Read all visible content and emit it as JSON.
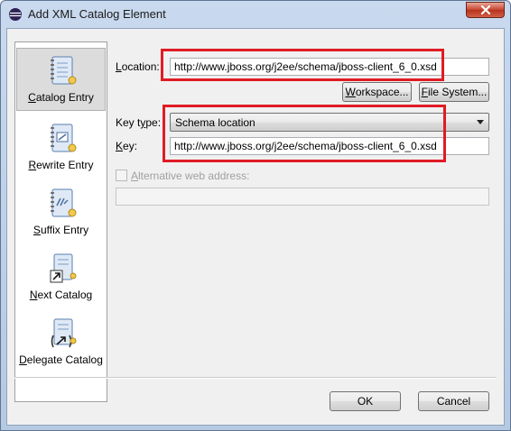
{
  "window": {
    "title": "Add XML Catalog Element"
  },
  "sidebar": {
    "items": [
      {
        "label": "Catalog Entry",
        "mnemonic": "C",
        "rest": "atalog Entry",
        "icon": "catalog-entry-icon",
        "selected": true
      },
      {
        "label": "Rewrite Entry",
        "mnemonic": "R",
        "rest": "ewrite Entry",
        "icon": "rewrite-entry-icon",
        "selected": false
      },
      {
        "label": "Suffix Entry",
        "mnemonic": "S",
        "rest": "uffix Entry",
        "icon": "suffix-entry-icon",
        "selected": false
      },
      {
        "label": "Next Catalog",
        "mnemonic": "N",
        "rest": "ext Catalog",
        "icon": "next-catalog-icon",
        "selected": false
      },
      {
        "label": "Delegate Catalog",
        "mnemonic": "D",
        "rest": "elegate Catalog",
        "icon": "delegate-catalog-icon",
        "selected": false
      }
    ]
  },
  "form": {
    "location": {
      "label_mnemonic": "L",
      "label_rest": "ocation:",
      "value": "http://www.jboss.org/j2ee/schema/jboss-client_6_0.xsd"
    },
    "workspace_button": {
      "mnemonic": "W",
      "rest": "orkspace..."
    },
    "filesystem_button": {
      "mnemonic": "F",
      "rest": "ile System..."
    },
    "key_type": {
      "label_pre": "Key t",
      "label_mnemonic": "y",
      "label_rest": "pe:",
      "selected": "Schema location"
    },
    "key": {
      "label_mnemonic": "K",
      "label_rest": "ey:",
      "value": "http://www.jboss.org/j2ee/schema/jboss-client_6_0.xsd"
    },
    "alternative": {
      "label_mnemonic": "A",
      "label_rest": "lternative web address:",
      "checked": false,
      "value": ""
    }
  },
  "footer": {
    "ok_label": "OK",
    "cancel_label": "Cancel"
  },
  "colors": {
    "highlight_box": "#e01b24"
  }
}
